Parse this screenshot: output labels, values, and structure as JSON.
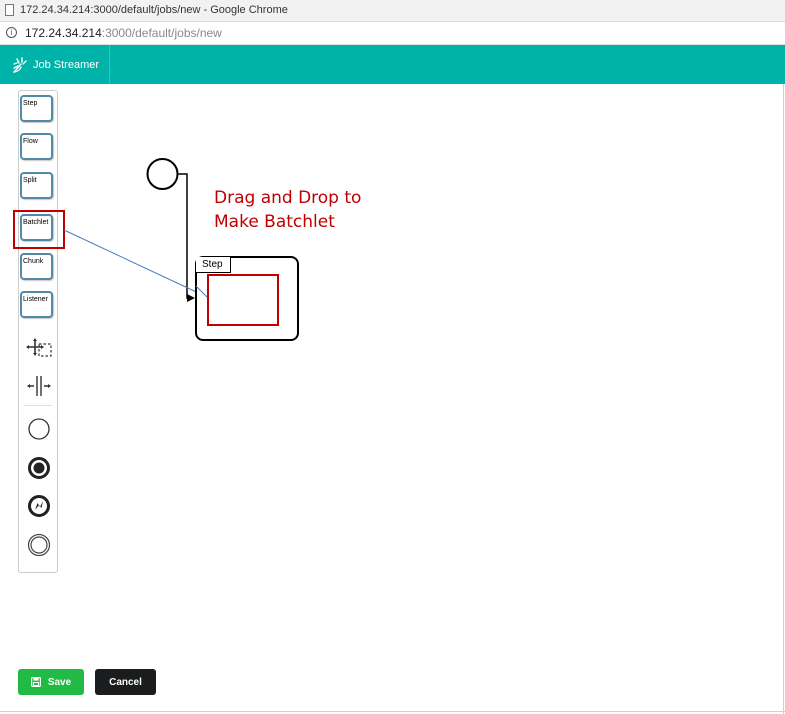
{
  "window": {
    "title": "172.24.34.214:3000/default/jobs/new - Google Chrome"
  },
  "address_bar": {
    "host": "172.24.34.214",
    "path": ":3000/default/jobs/new"
  },
  "app": {
    "brand": "Job Streamer",
    "accent_color": "#00b3a8"
  },
  "palette": {
    "items": [
      {
        "label": "Step"
      },
      {
        "label": "Flow"
      },
      {
        "label": "Split"
      },
      {
        "label": "Batchlet"
      },
      {
        "label": "Chunk"
      },
      {
        "label": "Listener"
      }
    ],
    "tools": [
      {
        "icon": "hand-tool-icon"
      },
      {
        "icon": "space-tool-icon"
      }
    ],
    "events": [
      {
        "icon": "start-event-icon"
      },
      {
        "icon": "end-event-icon"
      },
      {
        "icon": "error-event-icon"
      },
      {
        "icon": "intermediate-event-icon"
      }
    ]
  },
  "canvas": {
    "step_label": "Step",
    "annotation_line1": "Drag and Drop to",
    "annotation_line2": "Make Batchlet",
    "annotation_color": "#c00000"
  },
  "actions": {
    "save_label": "Save",
    "cancel_label": "Cancel",
    "save_color": "#21ba45",
    "cancel_color": "#1b1c1d"
  }
}
